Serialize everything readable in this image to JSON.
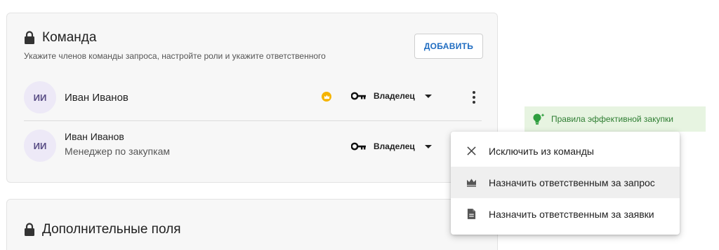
{
  "team_card": {
    "title": "Команда",
    "subtitle": "Укажите членов команды запроса, настройте роли и укажите ответственного",
    "add_button_label": "ДОБАВИТЬ",
    "members": [
      {
        "initials": "ИИ",
        "name": "Иван Иванов",
        "position": "",
        "responsible": true,
        "role": "Владелец"
      },
      {
        "initials": "ИИ",
        "name": "Иван Иванов",
        "position": "Менеджер по закупкам",
        "responsible": false,
        "role": "Владелец"
      }
    ]
  },
  "extra_card": {
    "title": "Дополнительные поля"
  },
  "tip": {
    "label": "Правила эффективной закупки",
    "icon": "lightbulb-icon",
    "color": "#2e7d32"
  },
  "context_menu": {
    "items": [
      {
        "label": "Исключить из команды",
        "icon": "close-icon"
      },
      {
        "label": "Назначить ответственным за запрос",
        "icon": "crown-icon"
      },
      {
        "label": "Назначить ответственным за заявки",
        "icon": "document-icon"
      }
    ]
  },
  "colors": {
    "accent": "#1f6cc1",
    "avatar_bg": "#ede9f7",
    "crown": "#f5b400"
  }
}
